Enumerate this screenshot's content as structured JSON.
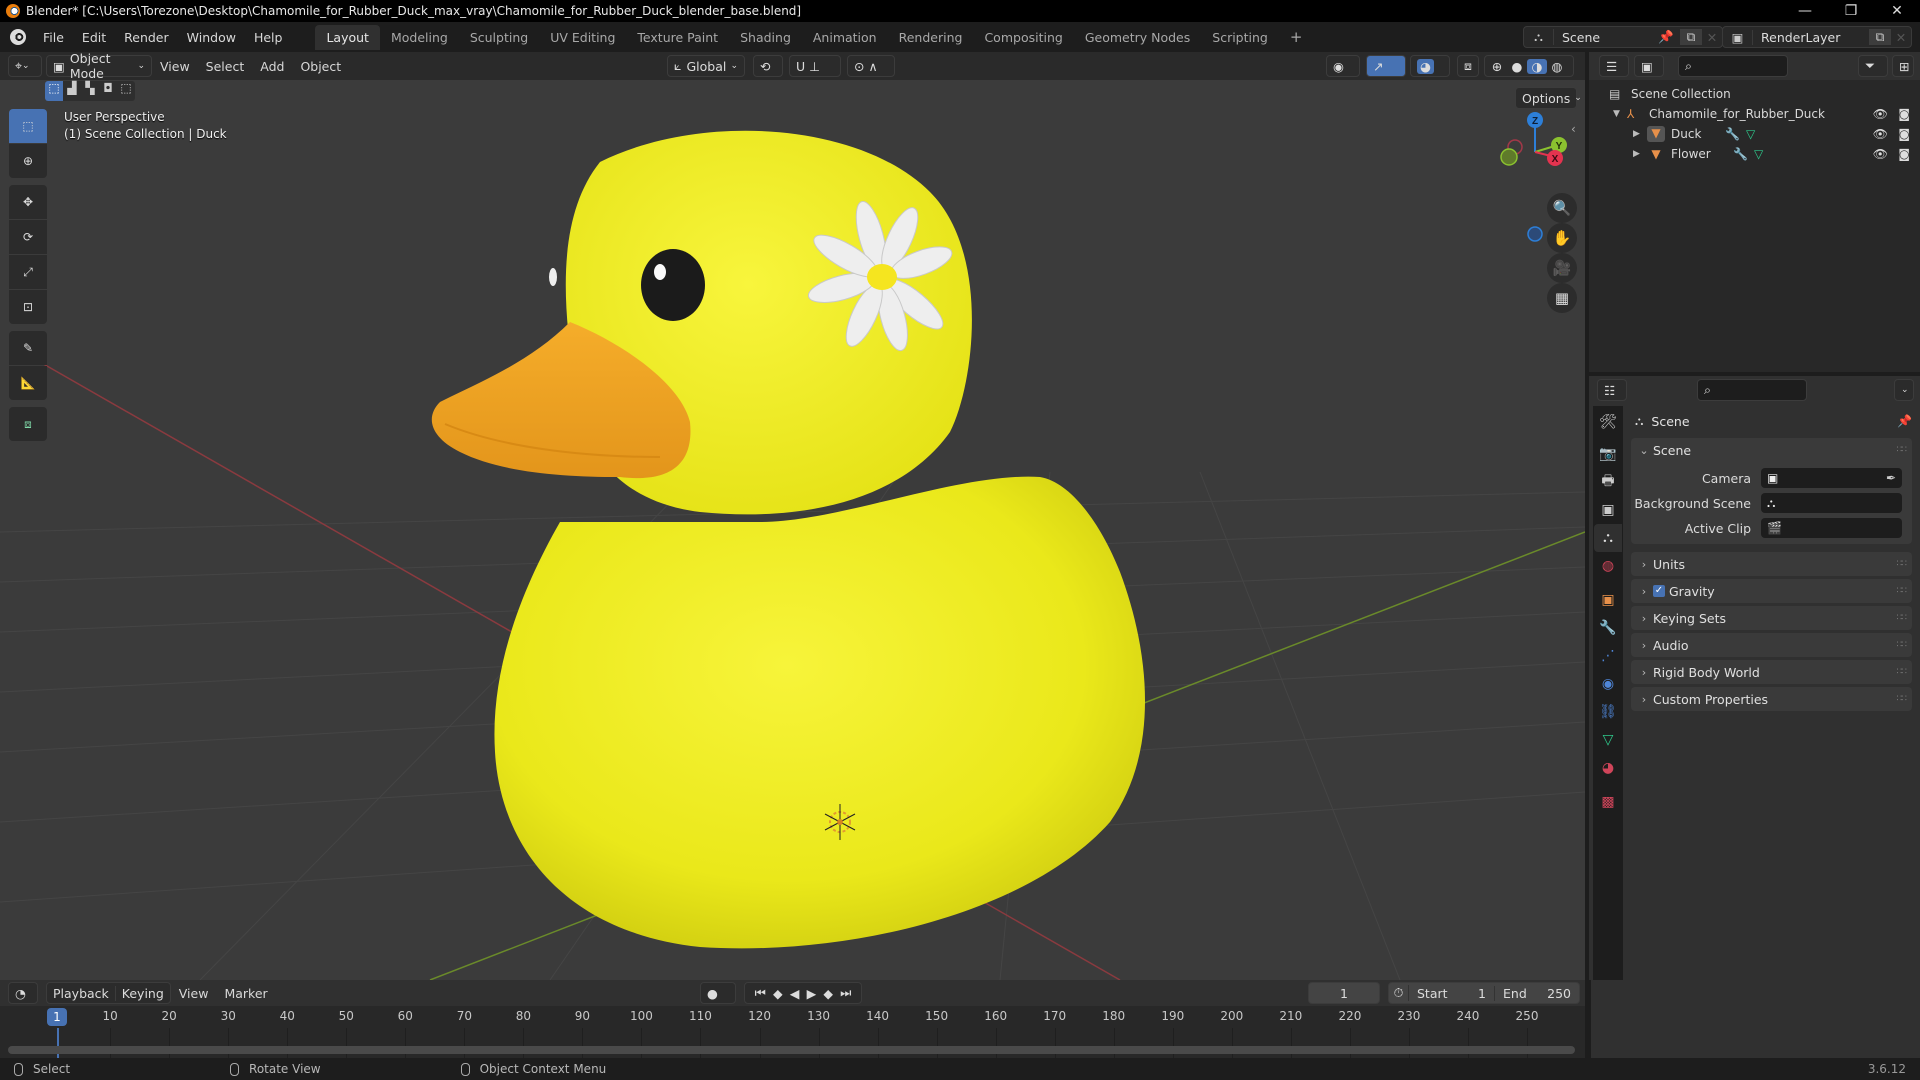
{
  "window": {
    "title": "Blender* [C:\\Users\\Torezone\\Desktop\\Chamomile_for_Rubber_Duck_max_vray\\Chamomile_for_Rubber_Duck_blender_base.blend]",
    "controls": {
      "minimize": "—",
      "maximize": "❐",
      "close": "✕"
    }
  },
  "menubar": {
    "menus": [
      "File",
      "Edit",
      "Render",
      "Window",
      "Help"
    ],
    "workspaces": [
      "Layout",
      "Modeling",
      "Sculpting",
      "UV Editing",
      "Texture Paint",
      "Shading",
      "Animation",
      "Rendering",
      "Compositing",
      "Geometry Nodes",
      "Scripting"
    ],
    "active_workspace": "Layout",
    "add_workspace": "+",
    "scene": "Scene",
    "view_layer": "RenderLayer"
  },
  "viewport": {
    "mode": "Object Mode",
    "menus": [
      "View",
      "Select",
      "Add",
      "Object"
    ],
    "transform_orientation": "Global",
    "options_label": "Options",
    "overlay_title": "User Perspective",
    "overlay_subtitle": "(1) Scene Collection | Duck",
    "gizmo_axes": {
      "z": "Z",
      "y": "Y",
      "x": "X"
    },
    "tools": [
      "select-box",
      "cursor",
      "move",
      "rotate",
      "scale",
      "transform",
      "annotate",
      "measure",
      "add-cube"
    ],
    "active_tool": "select-box",
    "colors": {
      "background": "#3b3b3b",
      "duck_body": "#f2ee1a",
      "beak": "#f2a623",
      "eye": "#1b1b1b",
      "petal": "#eeeeee",
      "flower_center": "#f5e51f",
      "x_axis": "#e3334f",
      "y_axis": "#8bc22f",
      "z_axis": "#2d7fd8"
    }
  },
  "outliner": {
    "root": "Scene Collection",
    "items": [
      {
        "name": "Chamomile_for_Rubber_Duck",
        "type": "empty",
        "expanded": true,
        "level": 1
      },
      {
        "name": "Duck",
        "type": "mesh",
        "expanded": false,
        "level": 2,
        "active": true
      },
      {
        "name": "Flower",
        "type": "mesh",
        "expanded": false,
        "level": 2,
        "active": false
      }
    ]
  },
  "properties": {
    "context_title": "Scene",
    "panels": {
      "scene": {
        "title": "Scene",
        "fields": [
          {
            "label": "Camera",
            "value": ""
          },
          {
            "label": "Background Scene",
            "value": ""
          },
          {
            "label": "Active Clip",
            "value": ""
          }
        ]
      },
      "collapsed": [
        "Units",
        "Gravity",
        "Keying Sets",
        "Audio",
        "Rigid Body World",
        "Custom Properties"
      ],
      "gravity_enabled": true
    },
    "tabs": [
      "tool",
      "render",
      "output",
      "view-layer",
      "scene",
      "world",
      "object",
      "modifiers",
      "particles",
      "physics",
      "constraints",
      "data",
      "material",
      "texture"
    ],
    "active_tab": "scene"
  },
  "timeline": {
    "menus": [
      "Playback",
      "Keying",
      "View",
      "Marker"
    ],
    "current_frame": "1",
    "start_label": "Start",
    "start": "1",
    "end_label": "End",
    "end": "250",
    "ticks": [
      "10",
      "20",
      "30",
      "40",
      "50",
      "60",
      "70",
      "80",
      "90",
      "100",
      "110",
      "120",
      "130",
      "140",
      "150",
      "160",
      "170",
      "180",
      "190",
      "200",
      "210",
      "220",
      "230",
      "240",
      "250"
    ],
    "playhead": "1"
  },
  "statusbar": {
    "hints": [
      "Select",
      "Rotate View",
      "Object Context Menu"
    ],
    "version": "3.6.12"
  }
}
